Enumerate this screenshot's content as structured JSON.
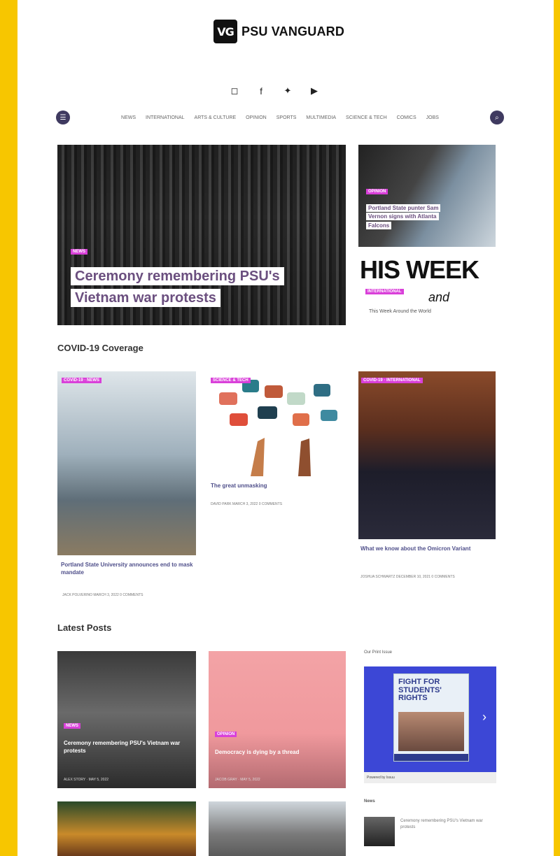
{
  "brand": {
    "logo_mark": "VG",
    "name": "PSU VANGUARD"
  },
  "social": [
    {
      "icon": "instagram-icon",
      "glyph": "◻"
    },
    {
      "icon": "facebook-icon",
      "glyph": "f"
    },
    {
      "icon": "twitter-icon",
      "glyph": "✦"
    },
    {
      "icon": "youtube-icon",
      "glyph": "▶"
    }
  ],
  "nav": {
    "left_icon": "menu-icon",
    "right_icon": "search-icon",
    "items": [
      "NEWS",
      "INTERNATIONAL",
      "ARTS & CULTURE",
      "OPINION",
      "SPORTS",
      "MULTIMEDIA",
      "SCIENCE & TECH",
      "COMICS",
      "JOBS"
    ]
  },
  "hero": {
    "tag": "NEWS",
    "title_line1": "Ceremony remembering PSU's",
    "title_line2": "Vietnam war protests"
  },
  "side_stories": [
    {
      "tag": "OPINION",
      "title_line1": "Portland State punter Sam",
      "title_line2": "Vernon signs with Atlanta",
      "title_line3": "Falcons"
    },
    {
      "big": "HIS WEEK",
      "sub": "and",
      "tag": "INTERNATIONAL",
      "title": "This Week Around the World"
    }
  ],
  "covid": {
    "heading": "COVID-19 Coverage",
    "cards": [
      {
        "tags": "COVID-19 · NEWS",
        "title": "Portland State University announces end to mask mandate",
        "meta": "JACK POLVERINO   MARCH 3, 2022   0 COMMENTS"
      },
      {
        "tags": "SCIENCE & TECH",
        "title": "The great unmasking",
        "meta": "DAVID PARK   MARCH 3, 2022   0 COMMENTS"
      },
      {
        "tags": "COVID-19 · INTERNATIONAL",
        "title": "What we know about the Omicron Variant",
        "meta": "JOSHUA SCHWARTZ   DECEMBER 10, 2021   0 COMMENTS"
      }
    ]
  },
  "latest": {
    "heading": "Latest Posts",
    "cards": [
      {
        "tag": "NEWS",
        "title": "Ceremony remembering PSU's Vietnam war protests",
        "meta": "ALEX STORY · MAY 5, 2022"
      },
      {
        "tag": "OPINION",
        "title": "Democracy is dying by a thread",
        "meta": "JACOB GRAY · MAY 5, 2022"
      }
    ],
    "right_label": "Our Print Issue",
    "issue": {
      "headline": "FIGHT FOR STUDENTS' RIGHTS",
      "bottom": "Powered by Issuu"
    },
    "news_label": "News",
    "news_item": "Ceremony remembering PSU's Vietnam war protests"
  },
  "colors": {
    "frame": "#f7c600",
    "accent_purple": "#6b4f7f",
    "tag_magenta": "#d940d9",
    "issue_blue": "#3c47d6"
  }
}
